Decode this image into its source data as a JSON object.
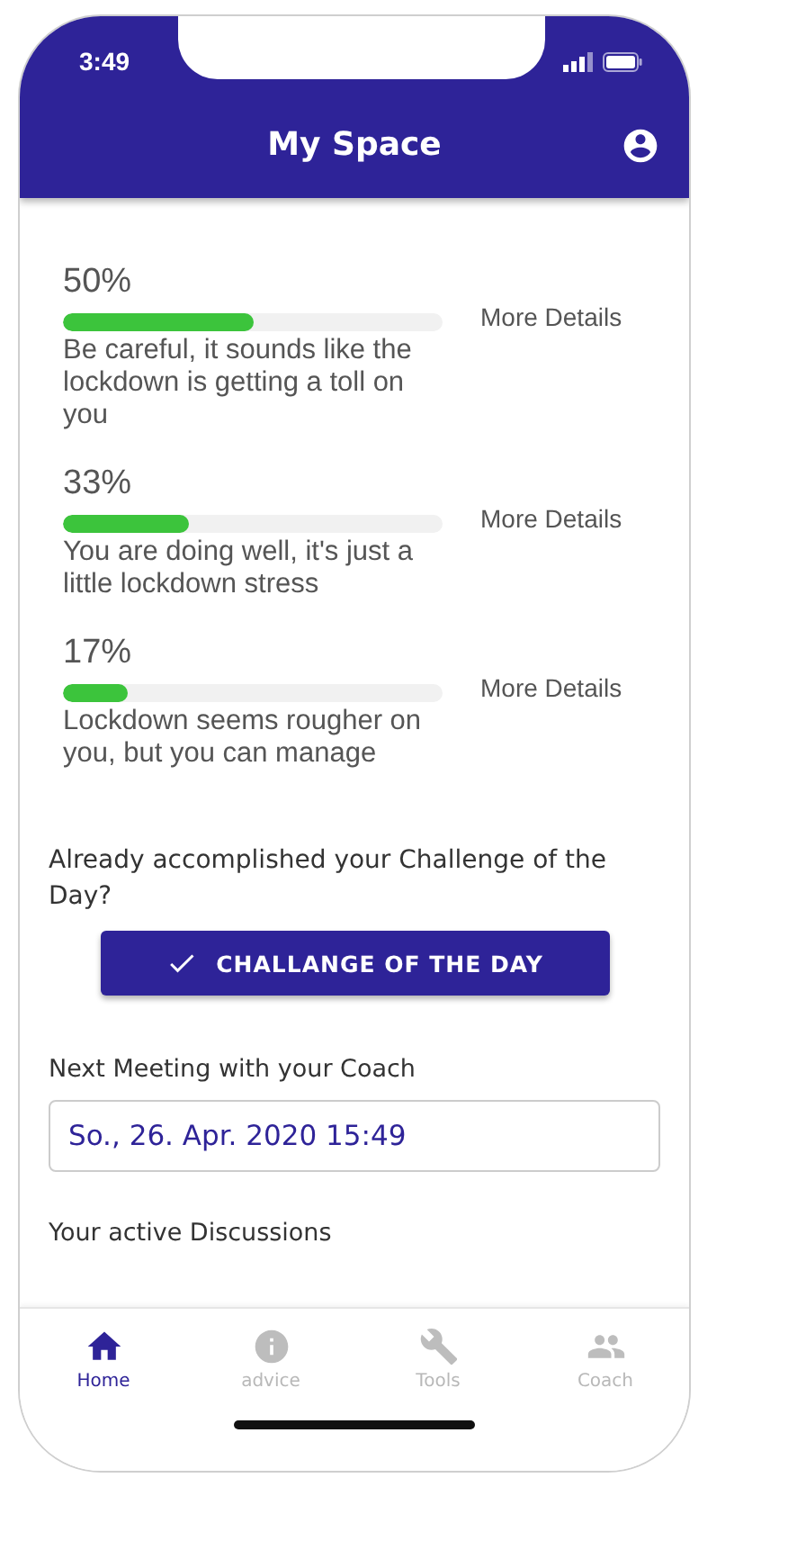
{
  "status_bar": {
    "time": "3:49"
  },
  "header": {
    "title": "My Space"
  },
  "scores": [
    {
      "percent": "50%",
      "level": 0.5,
      "description": "Be careful, it sounds like the lockdown is getting a toll on you",
      "link": "More Details"
    },
    {
      "percent": "33%",
      "level": 0.33,
      "description": "You are doing well, it's just a little lockdown stress",
      "link": "More Details"
    },
    {
      "percent": "17%",
      "level": 0.17,
      "description": "Lockdown seems rougher on you, but you can manage",
      "link": "More Details"
    }
  ],
  "challenge": {
    "question": "Already accomplished your Challenge of the Day?",
    "button": "CHALLANGE OF THE DAY"
  },
  "meeting": {
    "label": "Next Meeting with your Coach",
    "value": "So., 26. Apr. 2020 15:49"
  },
  "discussions": {
    "title": "Your active Discussions"
  },
  "nav": [
    {
      "label": "Home",
      "selected": true
    },
    {
      "label": "advice",
      "selected": false
    },
    {
      "label": "Tools",
      "selected": false
    },
    {
      "label": "Coach",
      "selected": false
    }
  ]
}
